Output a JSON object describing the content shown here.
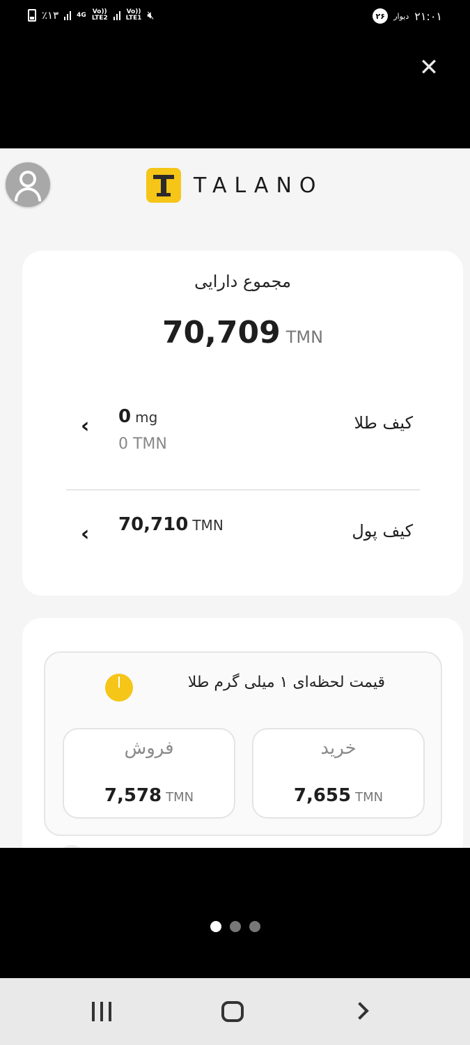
{
  "status_bar": {
    "battery_percent": "٪۱۳",
    "network_4g": "4G",
    "network_sim2": "LTE2",
    "network_sim1": "LTE1",
    "volte": "Vo))",
    "time": "۲۱:۰۱",
    "notification_count": "۲۶",
    "notification_app": "دیوار"
  },
  "overlay": {
    "close_glyph": "✕"
  },
  "app": {
    "brand": "TALANO",
    "assets": {
      "title": "مجموع دارایی",
      "total_value": "70,709",
      "total_unit": "TMN",
      "gold_wallet": {
        "label": "کیف طلا",
        "amount": "0",
        "amount_unit": "mg",
        "value": "0 TMN"
      },
      "cash_wallet": {
        "label": "کیف پول",
        "amount": "70,710",
        "amount_unit": "TMN"
      }
    },
    "live_price": {
      "title": "قیمت لحظه‌ای ۱ میلی گرم طلا",
      "sell": {
        "label": "فروش",
        "value": "7,578",
        "unit": "TMN"
      },
      "buy": {
        "label": "خرید",
        "value": "7,655",
        "unit": "TMN"
      }
    }
  },
  "pager": {
    "count": 3,
    "active_index": 0
  },
  "colors": {
    "accent": "#f5c518",
    "panel_bg": "#f5f5f5",
    "card_bg": "#ffffff"
  }
}
